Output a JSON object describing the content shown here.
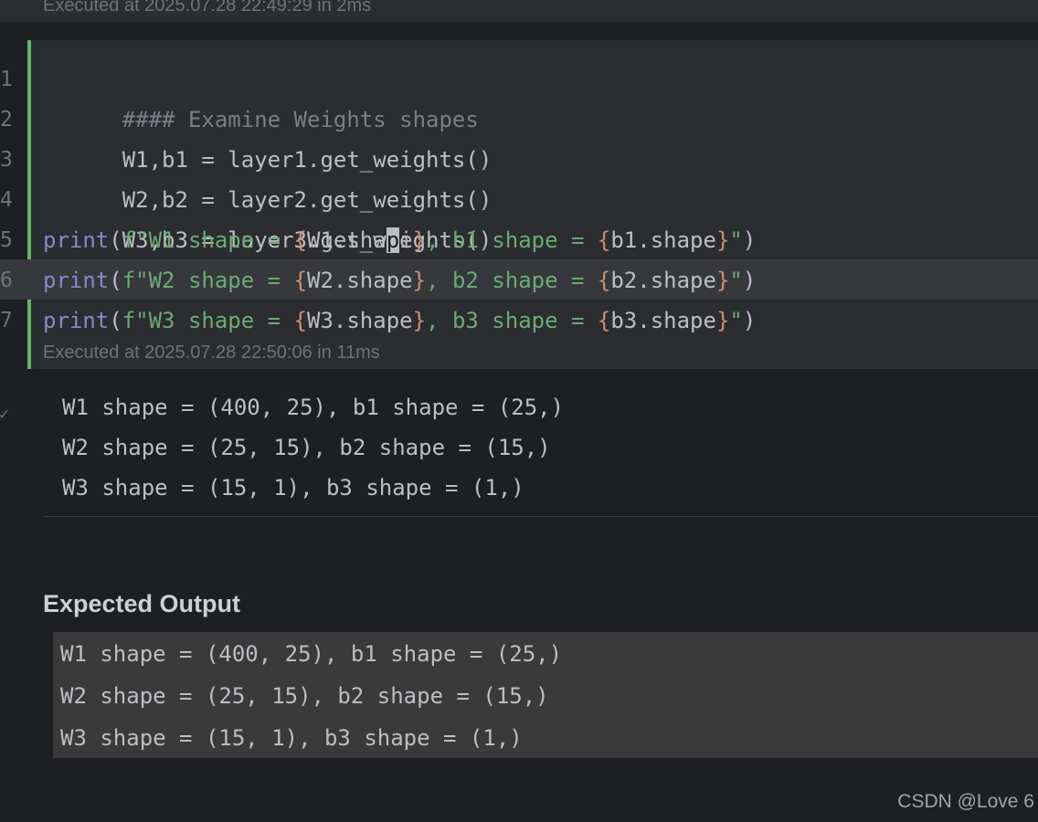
{
  "previous_cell": {
    "exec_status": "Executed at 2025.07.28 22:49:29 in 2ms"
  },
  "code_cell": {
    "line_numbers": [
      "1",
      "2",
      "3",
      "4",
      "5",
      "6",
      "7"
    ],
    "lines": {
      "l1_comment": "#### Examine Weights shapes",
      "l2": "W1,b1 = layer1.get_weights()",
      "l3": "W2,b2 = layer2.get_weights()",
      "l4": "W3,b3 = layer3.get_weights()",
      "print_fn": "print",
      "open_paren": "(",
      "fstr_prefix_1": "f\"W1 shape = ",
      "fstr_prefix_2": "f\"W2 shape = ",
      "fstr_prefix_3": "f\"W3 shape = ",
      "brace_open": "{",
      "brace_close": "}",
      "expr_w1_a": "W1.sha",
      "expr_w1_caret": "p",
      "expr_w1_b": "e",
      "expr_w2": "W2.shape",
      "expr_w3": "W3.shape",
      "mid_1": ", b1 shape = ",
      "mid_2": ", b2 shape = ",
      "mid_3": ", b3 shape = ",
      "expr_b1": "b1.shape",
      "expr_b2": "b2.shape",
      "expr_b3": "b3.shape",
      "close_quote": "\"",
      "close_paren": ")"
    },
    "exec_status": "Executed at 2025.07.28 22:50:06 in 11ms",
    "current_line": 5
  },
  "output": {
    "status_icon": "checkmark-icon",
    "lines": [
      "W1 shape = (400, 25), b1 shape = (25,)",
      "W2 shape = (25, 15), b2 shape = (15,)",
      "W3 shape = (15, 1), b3 shape = (1,)"
    ]
  },
  "markdown": {
    "heading": "Expected Output",
    "code_lines": [
      "W1 shape = (400, 25), b1 shape = (25,)",
      "W2 shape = (25, 15), b2 shape = (15,)",
      "W3 shape = (15, 1), b3 shape = (1,)"
    ]
  },
  "watermark": "CSDN @Love 6",
  "colors": {
    "background": "#1e1f22",
    "cell_background": "#2b2d30",
    "cell_accent": "#5fb865",
    "comment": "#7a7e85",
    "builtin_fn": "#8888c6",
    "string": "#6aab73",
    "brace": "#cf8e6d",
    "text": "#bcbec4"
  }
}
